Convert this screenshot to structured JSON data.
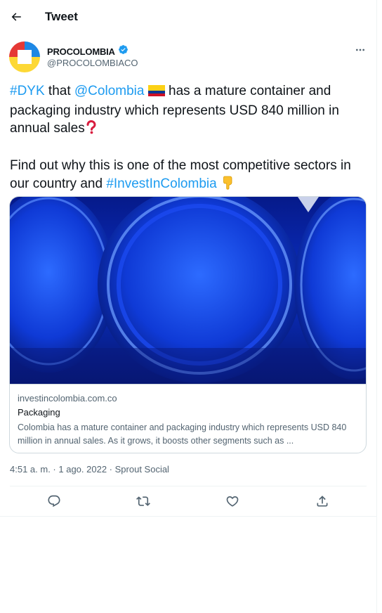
{
  "header": {
    "title": "Tweet"
  },
  "author": {
    "name": "PROCOLOMBIA",
    "handle": "@PROCOLOMBIACO"
  },
  "tweet": {
    "line1": {
      "tag1": "#DYK",
      "t1": " that ",
      "mention": "@Colombia",
      "t2": " has a mature container and packaging industry which represents USD 840 million in annual sales"
    },
    "line2": {
      "t1": "Find out why this is one of the most competitive sectors in our country and ",
      "tag2": "#InvestInColombia"
    }
  },
  "card": {
    "domain": "investincolombia.com.co",
    "title": "Packaging",
    "description": "Colombia has a mature container and packaging industry which represents USD 840 million in annual sales. As it grows, it boosts other segments such as ..."
  },
  "meta": {
    "time": "4:51 a. m.",
    "date": "1 ago. 2022",
    "source": "Sprout Social",
    "dot": " · "
  },
  "icons": {
    "back": "arrow-left-icon",
    "verified": "verified-badge-icon",
    "more": "more-horizontal-icon",
    "reply": "reply-icon",
    "retweet": "retweet-icon",
    "like": "heart-icon",
    "share": "share-icon"
  },
  "colors": {
    "accent": "#1d9bf0",
    "text": "#0f1419",
    "secondary": "#536471",
    "border": "#cfd9de"
  }
}
